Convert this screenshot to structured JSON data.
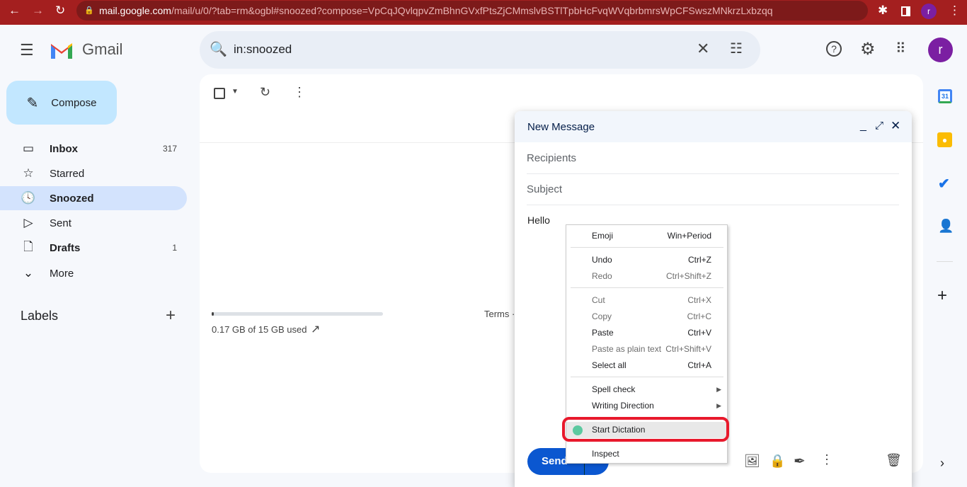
{
  "browser": {
    "url_host": "mail.google.com",
    "url_rest": "/mail/u/0/?tab=rm&ogbl#snoozed?compose=VpCqJQvlqpvZmBhnGVxfPtsZjCMmslvBSTlTpbHcFvqWVqbrbmrsWpCFSwszMNkrzLxbzqq",
    "profile_initial": "r"
  },
  "header": {
    "app_name": "Gmail",
    "search_value": "in:snoozed",
    "avatar_initial": "r"
  },
  "sidebar": {
    "compose_label": "Compose",
    "items": [
      {
        "label": "Inbox",
        "count": "317",
        "icon": "inbox-icon"
      },
      {
        "label": "Starred",
        "count": "",
        "icon": "star-icon"
      },
      {
        "label": "Snoozed",
        "count": "",
        "icon": "clock-icon"
      },
      {
        "label": "Sent",
        "count": "",
        "icon": "send-icon"
      },
      {
        "label": "Drafts",
        "count": "1",
        "icon": "draft-icon"
      },
      {
        "label": "More",
        "count": "",
        "icon": "chevron-down-icon"
      }
    ],
    "labels_heading": "Labels"
  },
  "main": {
    "storage_text": "0.17 GB of 15 GB used",
    "storage_fraction": 0.011,
    "terms_text": "Terms ·"
  },
  "compose": {
    "title": "New Message",
    "recipients_placeholder": "Recipients",
    "subject_placeholder": "Subject",
    "body": "Hello",
    "send_label": "Send"
  },
  "context_menu": {
    "items": [
      {
        "label": "Emoji",
        "shortcut": "Win+Period"
      },
      {
        "label": "Undo",
        "shortcut": "Ctrl+Z"
      },
      {
        "label": "Redo",
        "shortcut": "Ctrl+Shift+Z"
      },
      {
        "label": "Cut",
        "shortcut": "Ctrl+X"
      },
      {
        "label": "Copy",
        "shortcut": "Ctrl+C"
      },
      {
        "label": "Paste",
        "shortcut": "Ctrl+V"
      },
      {
        "label": "Paste as plain text",
        "shortcut": "Ctrl+Shift+V"
      },
      {
        "label": "Select all",
        "shortcut": "Ctrl+A"
      },
      {
        "label": "Spell check",
        "shortcut": ""
      },
      {
        "label": "Writing Direction",
        "shortcut": ""
      },
      {
        "label": "Start Dictation",
        "shortcut": ""
      },
      {
        "label": "Inspect",
        "shortcut": ""
      }
    ]
  },
  "colors": {
    "highlight": "#e8192c",
    "accent": "#0b57d0",
    "browser_bar": "#a41f1f"
  }
}
